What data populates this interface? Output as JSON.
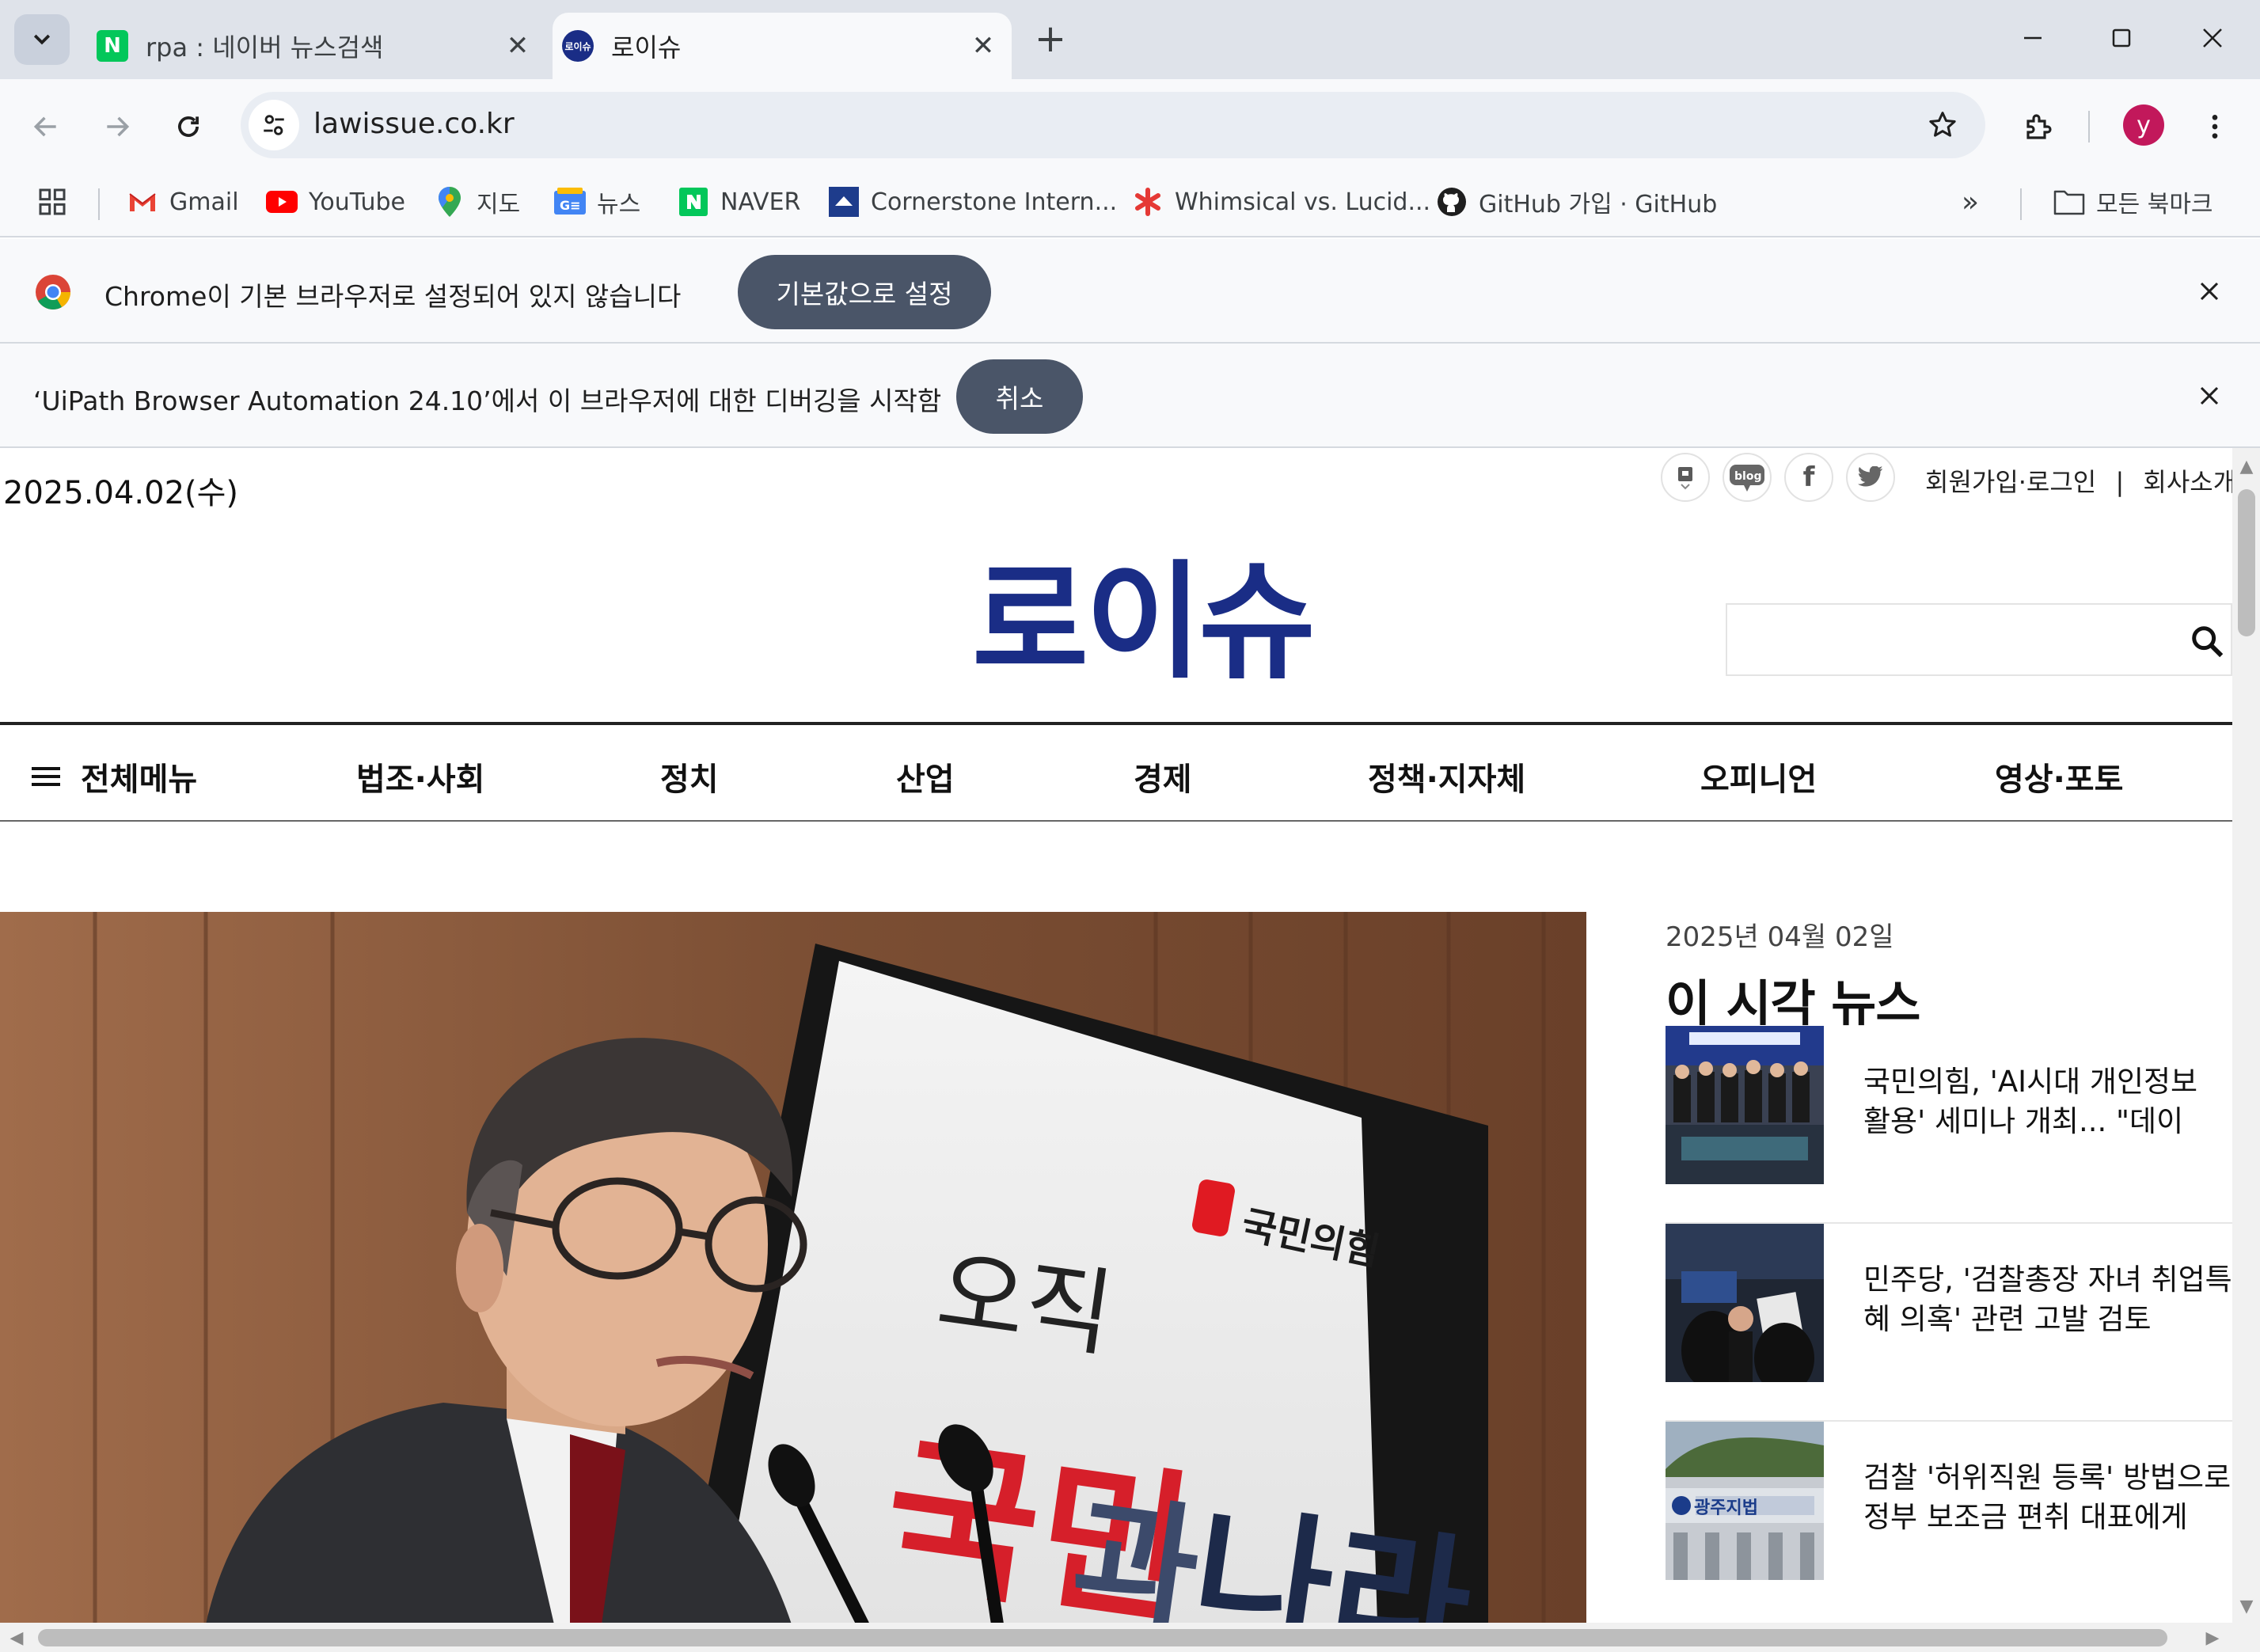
{
  "browser": {
    "tabs": [
      {
        "title": "rpa : 네이버 뉴스검색",
        "favicon": "N",
        "favicon_color": "#03c75a",
        "active": false
      },
      {
        "title": "로이슈",
        "favicon": "로이슈",
        "favicon_color": "#1a2d86",
        "active": true
      }
    ],
    "url": "lawissue.co.kr",
    "profile_initial": "y",
    "bookmarks": [
      {
        "label": "Gmail",
        "icon": "gmail-icon"
      },
      {
        "label": "YouTube",
        "icon": "youtube-icon"
      },
      {
        "label": "지도",
        "icon": "maps-icon"
      },
      {
        "label": "뉴스",
        "icon": "news-icon"
      },
      {
        "label": "NAVER",
        "icon": "naver-icon"
      },
      {
        "label": "Cornerstone Intern...",
        "icon": "cornerstone-icon"
      },
      {
        "label": "Whimsical vs. Lucid...",
        "icon": "whimsical-icon"
      },
      {
        "label": "GitHub 가입 · GitHub",
        "icon": "github-icon"
      }
    ],
    "all_bookmarks": "모든 북마크",
    "overflow": "»",
    "infobars": [
      {
        "message": "Chrome이 기본 브라우저로 설정되어 있지 않습니다",
        "button": "기본값으로 설정"
      },
      {
        "message": "‘UiPath Browser Automation 24.10’에서 이 브라우저에 대한 디버깅을 시작함",
        "button": "취소"
      }
    ]
  },
  "site": {
    "date": "2025.04.02(수)",
    "logo": "로이슈",
    "top_links": {
      "login": "회원가입·로그인",
      "separator": "|",
      "about": "회사소개"
    },
    "sns": [
      {
        "name": "news-icon"
      },
      {
        "name": "blog-icon",
        "label": "blog"
      },
      {
        "name": "facebook-icon",
        "label": "f"
      },
      {
        "name": "twitter-icon"
      }
    ],
    "search": {
      "placeholder": ""
    },
    "nav": {
      "all_menu": "전체메뉴",
      "items": [
        "법조·사회",
        "정치",
        "산업",
        "경제",
        "정책·지자체",
        "오피니언",
        "영상·포토"
      ]
    },
    "hero": {
      "podium_small": "국민의힘",
      "podium_line1": "오직",
      "podium_line2_red": "국민",
      "podium_line2_mid": "과",
      "podium_line2_dark": "나라"
    },
    "sidebar": {
      "date": "2025년 04월 02일",
      "title": "이 시각 뉴스",
      "items": [
        {
          "headline": "국민의힘, 'AI시대 개인정보 활용' 세미나 개최... \"데이터..."
        },
        {
          "headline": "민주당, '검찰총장 자녀 취업특혜 의혹' 관련 고발 검토"
        },
        {
          "headline": "검찰 '허위직원 등록' 방법으로 정부 보조금 편취 대표에게 징..."
        }
      ]
    }
  },
  "colors": {
    "logo": "#1a2d86",
    "pill": "#4a5568",
    "tabbar": "#dfe3ea"
  }
}
